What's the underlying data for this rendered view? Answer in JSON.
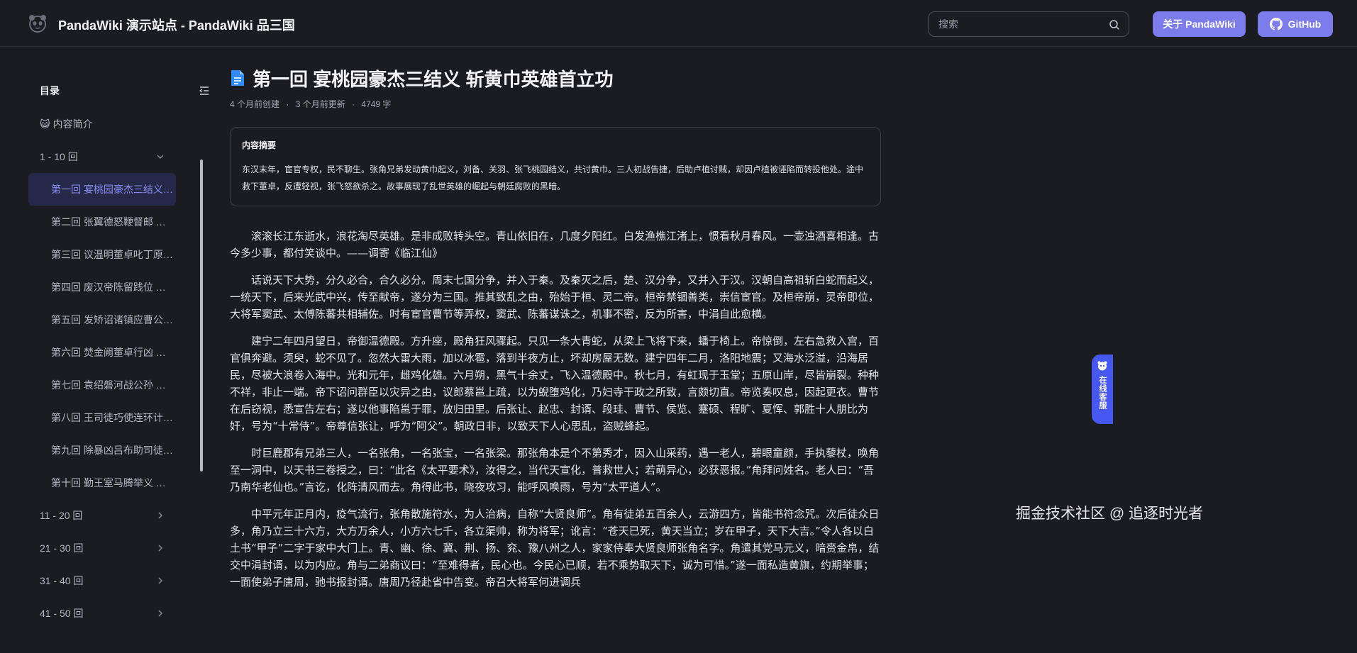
{
  "header": {
    "site_title": "PandaWiki 演示站点 - PandaWiki 品三国",
    "search_placeholder": "搜索",
    "about_button": "关于 PandaWiki",
    "github_button": "GitHub"
  },
  "sidebar": {
    "title": "目录",
    "items": [
      {
        "label": "😺 内容简介",
        "type": "doc"
      },
      {
        "label": "1 - 10 回",
        "type": "group-open"
      },
      {
        "label": "第一回 宴桃园豪杰三结义 斩黄巾英雄首立功",
        "type": "child-active"
      },
      {
        "label": "第二回 张翼德怒鞭督邮 何国舅谋诛宦竖",
        "type": "child"
      },
      {
        "label": "第三回 议温明董卓叱丁原 馈金珠李肃说吕布",
        "type": "child"
      },
      {
        "label": "第四回 废汉帝陈留践位 谋董贼孟德献刀",
        "type": "child"
      },
      {
        "label": "第五回 发矫诏诸镇应曹公 破关兵三英战吕布",
        "type": "child"
      },
      {
        "label": "第六回 焚金阙董卓行凶 匿玉玺孙坚背约",
        "type": "child"
      },
      {
        "label": "第七回 袁绍磐河战公孙 孙坚跨江击刘表",
        "type": "child"
      },
      {
        "label": "第八回 王司徒巧使连环计 董太师大闹凤仪亭",
        "type": "child"
      },
      {
        "label": "第九回 除暴凶吕布助司徒 犯长安李傕听贾诩",
        "type": "child"
      },
      {
        "label": "第十回 勤王室马腾举义 报父仇曹操兴师",
        "type": "child"
      },
      {
        "label": "11 - 20 回",
        "type": "group"
      },
      {
        "label": "21 - 30 回",
        "type": "group"
      },
      {
        "label": "31 - 40 回",
        "type": "group"
      },
      {
        "label": "41 - 50 回",
        "type": "group"
      }
    ]
  },
  "document": {
    "title": "第一回 宴桃园豪杰三结义 斩黄巾英雄首立功",
    "created": "4 个月前创建",
    "updated": "3 个月前更新",
    "words": "4749 字",
    "separator": "·",
    "summary_title": "内容摘要",
    "summary_text": "东汉末年，宦官专权，民不聊生。张角兄弟发动黄巾起义，刘备、关羽、张飞桃园结义，共讨黄巾。三人初战告捷，后助卢植讨贼，却因卢植被诬陷而转投他处。途中救下董卓，反遭轻视，张飞怒欲杀之。故事展现了乱世英雄的崛起与朝廷腐败的黑暗。",
    "paragraphs": [
      "滚滚长江东逝水，浪花淘尽英雄。是非成败转头空。青山依旧在，几度夕阳红。白发渔樵江渚上，惯看秋月春风。一壶浊酒喜相逢。古今多少事，都付笑谈中。——调寄《临江仙》",
      "话说天下大势，分久必合，合久必分。周末七国分争，并入于秦。及秦灭之后，楚、汉分争，又并入于汉。汉朝自高祖斩白蛇而起义，一统天下，后来光武中兴，传至献帝，遂分为三国。推其致乱之由，殆始于桓、灵二帝。桓帝禁锢善类，崇信宦官。及桓帝崩，灵帝即位，大将军窦武、太傅陈蕃共相辅佐。时有宦官曹节等弄权，窦武、陈蕃谋诛之，机事不密，反为所害，中涓自此愈横。",
      "建宁二年四月望日，帝御温德殿。方升座，殿角狂风骤起。只见一条大青蛇，从梁上飞将下来，蟠于椅上。帝惊倒，左右急救入宫，百官俱奔避。须臾，蛇不见了。忽然大雷大雨，加以冰雹，落到半夜方止，坏却房屋无数。建宁四年二月，洛阳地震；又海水泛溢，沿海居民，尽被大浪卷入海中。光和元年，雌鸡化雄。六月朔，黑气十余丈，飞入温德殿中。秋七月，有虹现于玉堂；五原山岸，尽皆崩裂。种种不祥，非止一端。帝下诏问群臣以灾异之由，议郎蔡邕上疏，以为蜺堕鸡化，乃妇寺干政之所致，言颇切直。帝览奏叹息，因起更衣。曹节在后窃视，悉宣告左右；遂以他事陷邕于罪，放归田里。后张让、赵忠、封谞、段珪、曹节、侯览、蹇硕、程旷、夏恽、郭胜十人朋比为奸，号为“十常侍”。帝尊信张让，呼为“阿父”。朝政日非，以致天下人心思乱，盗贼蜂起。",
      "时巨鹿郡有兄弟三人，一名张角，一名张宝，一名张梁。那张角本是个不第秀才，因入山采药，遇一老人，碧眼童颜，手执藜杖，唤角至一洞中，以天书三卷授之，曰：“此名《太平要术》，汝得之，当代天宣化，普救世人；若萌异心，必获恶报。”角拜问姓名。老人曰：“吾乃南华老仙也。”言讫，化阵清风而去。角得此书，晓夜攻习，能呼风唤雨，号为“太平道人”。",
      "中平元年正月内，疫气流行，张角散施符水，为人治病，自称“大贤良师”。角有徒弟五百余人，云游四方，皆能书符念咒。次后徒众日多，角乃立三十六方，大方万余人，小方六七千，各立渠帅，称为将军；讹言：“苍天已死，黄天当立；岁在甲子，天下大吉。”令人各以白土书“甲子”二字于家中大门上。青、幽、徐、冀、荆、扬、兖、豫八州之人，家家侍奉大贤良师张角名字。角遣其党马元义，暗赍金帛，结交中涓封谞，以为内应。角与二弟商议曰：“至难得者，民心也。今民心已顺，若不乘势取天下，诚为可惜。”遂一面私造黄旗，约期举事；一面使弟子唐周，驰书报封谞。唐周乃径赴省中告变。帝召大将军何进调兵"
    ]
  },
  "service": {
    "label": "在线客服"
  },
  "watermark": "掘金技术社区 @ 追逐时光者"
}
